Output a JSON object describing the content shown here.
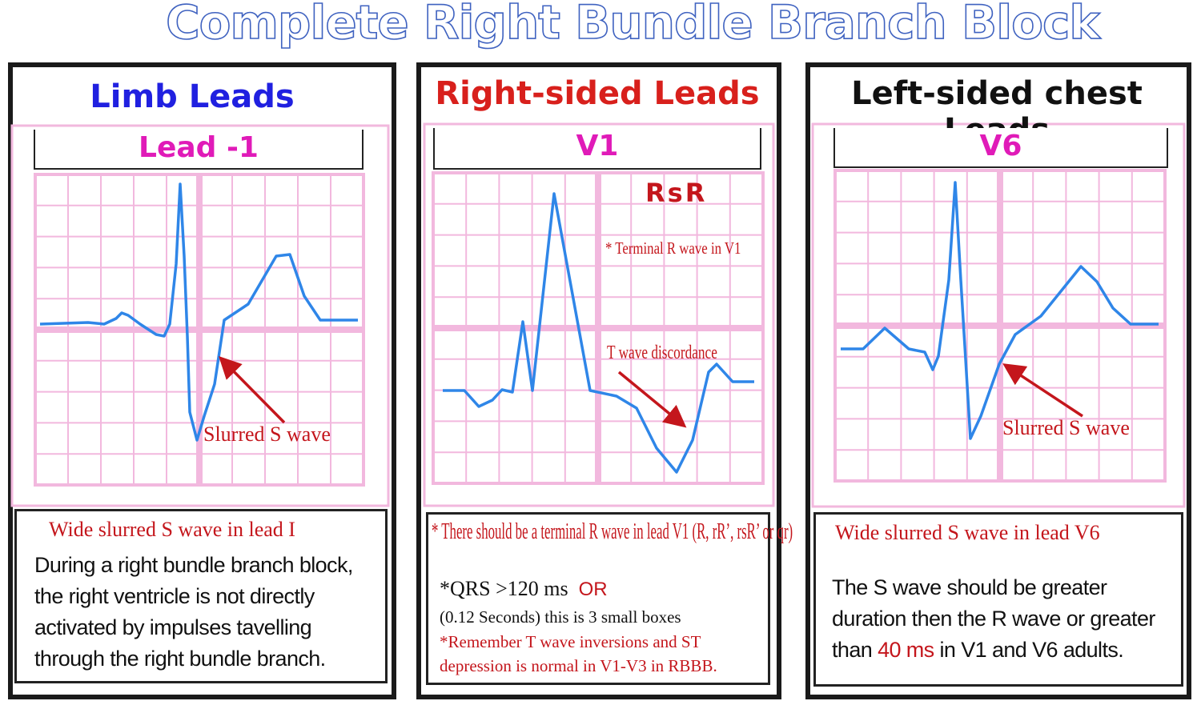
{
  "title": "Complete Right Bundle Branch Block",
  "colors": {
    "trace": "#2f86e8",
    "grid": "#f2b8de",
    "arrow": "#c4161c",
    "title_outline": "#3f62c0"
  },
  "panels": [
    {
      "heading": "Limb Leads",
      "heading_color": "#2020e0",
      "lead": "Lead -1",
      "annotation": "Slurred S wave",
      "caption": "Wide slurred S wave in lead I",
      "body": "During a right bundle branch block, the right ventricle is not directly activated by impulses tavelling through the right bundle branch."
    },
    {
      "heading": "Right-sided Leads",
      "heading_color": "#d8201c",
      "lead": "V1",
      "label_top": "RsR",
      "note": "* Terminal R wave in V1",
      "annotation": "T wave discordance",
      "caption": "* There should be a terminal R wave in lead V1 (R, rR’, rsR’ or qr)",
      "qrs": "*QRS >120 ms",
      "or": "OR",
      "seconds": "(0.12 Seconds) this is 3 small boxes",
      "remember": "*Remember T wave inversions and ST depression is normal in V1-V3 in RBBB."
    },
    {
      "heading": "Left-sided chest Leads",
      "heading_color": "#111111",
      "lead": "V6",
      "annotation": "Slurred S wave",
      "caption": "Wide slurred S wave in lead V6",
      "body_pre": "The S wave should be greater duration then the R wave or greater than ",
      "body_hl": "40 ms",
      "body_post": " in V1 and V6 adults."
    }
  ]
}
